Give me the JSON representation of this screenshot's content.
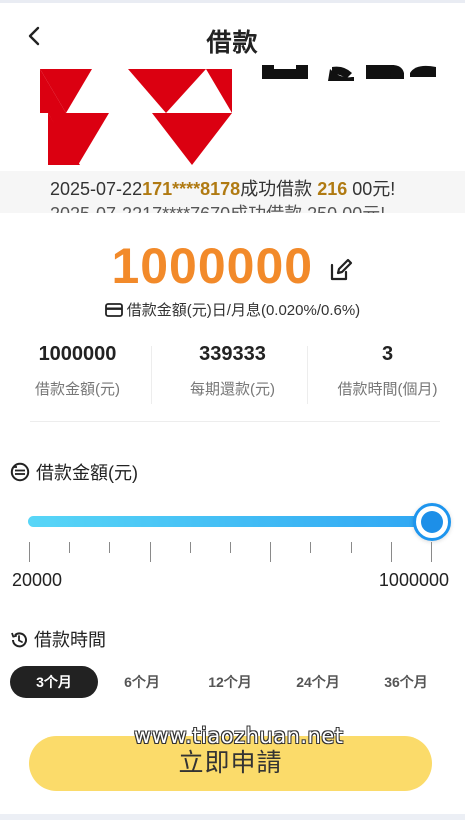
{
  "header": {
    "title": "借款",
    "back_icon": "chevron-left-icon"
  },
  "banner": {
    "logo_name": "hsbc-logo",
    "logo_color": "#db0011"
  },
  "ticker": {
    "line1": {
      "date": "2025-07-22",
      "phone": "171****8178",
      "text1": "成功借款 ",
      "amount": "216",
      "tail": "00元!"
    },
    "line2_partial": "2025-07-2217****7670成功借款 250 00元!"
  },
  "amount": {
    "value": "1000000",
    "edit_icon": "edit-icon",
    "rate_icon": "credit-card-icon",
    "rate_text": "借款金額(元)日/月息(0.020%/0.6%)"
  },
  "stats": [
    {
      "value": "1000000",
      "label": "借款金額(元)"
    },
    {
      "value": "339333",
      "label": "每期還款(元)"
    },
    {
      "value": "3",
      "label": "借款時間(個月)"
    }
  ],
  "loan_amount_section": {
    "icon": "coin-icon",
    "title": "借款金額(元)",
    "slider": {
      "min_label": "20000",
      "max_label": "1000000",
      "level": 1.0
    }
  },
  "term_section": {
    "icon": "history-icon",
    "title": "借款時間",
    "options": [
      "3个月",
      "6个月",
      "12个月",
      "24个月",
      "36个月"
    ],
    "selected": "3个月"
  },
  "apply_button": {
    "label": "立即申請"
  },
  "watermark": "www.tiaozhuan.net",
  "colors": {
    "accent_orange": "#f28a2a",
    "highlight": "#b07a12",
    "slider_start": "#58d6f7",
    "slider_end": "#2fa6f3",
    "thumb": "#1d95ee",
    "button": "#fbdb6a",
    "active_term": "#222222"
  }
}
